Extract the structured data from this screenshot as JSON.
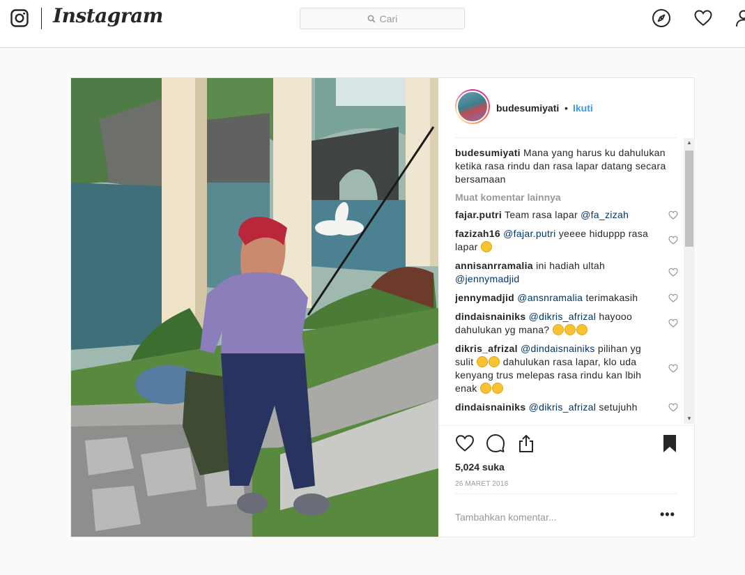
{
  "app": {
    "wordmark": "Instagram",
    "search": {
      "placeholder": "Cari"
    }
  },
  "nav_icons": [
    "compass-icon",
    "heart-icon",
    "profile-icon"
  ],
  "post": {
    "username": "budesumiyati",
    "header_separator": "•",
    "follow_label": "Ikuti",
    "caption": {
      "username": "budesumiyati",
      "text": "Mana yang harus ku dahulukan ketika rasa rindu dan rasa lapar datang secara bersamaan"
    },
    "load_more_label": "Muat komentar lainnya",
    "comments": [
      {
        "username": "fajar.putri",
        "parts": [
          {
            "t": "Team rasa lapar "
          },
          {
            "m": "@fa_zizah"
          }
        ]
      },
      {
        "username": "fazizah16",
        "parts": [
          {
            "m": "@fajar.putri"
          },
          {
            "t": " yeeee hiduppp rasa lapar "
          },
          {
            "e": "grin-sweat"
          }
        ]
      },
      {
        "username": "annisanrramalia",
        "parts": [
          {
            "t": "ini hadiah ultah "
          },
          {
            "m": "@jennymadjid"
          }
        ]
      },
      {
        "username": "jennymadjid",
        "parts": [
          {
            "m": "@ansnramalia"
          },
          {
            "t": " terimakasih"
          }
        ]
      },
      {
        "username": "dindaisnainiks",
        "parts": [
          {
            "m": "@dikris_afrizal"
          },
          {
            "t": " hayooo dahulukan yg mana? "
          },
          {
            "e": "rofl"
          },
          {
            "e": "rofl"
          },
          {
            "e": "rofl"
          }
        ]
      },
      {
        "username": "dikris_afrizal",
        "parts": [
          {
            "m": "@dindaisnainiks"
          },
          {
            "t": " pilihan yg sulit "
          },
          {
            "e": "rofl"
          },
          {
            "e": "rofl"
          },
          {
            "t": " dahulukan rasa lapar, klo uda kenyang trus melepas rasa rindu kan lbih enak "
          },
          {
            "e": "grin-sweat"
          },
          {
            "e": "grin-sweat"
          }
        ]
      },
      {
        "username": "dindaisnainiks",
        "parts": [
          {
            "m": "@dikris_afrizal"
          },
          {
            "t": " setujuhh"
          }
        ]
      }
    ],
    "likes": "5,024 suka",
    "date": "26 MARET 2018",
    "add_comment_placeholder": "Tambahkan komentar...",
    "more_options": "•••"
  },
  "colors": {
    "link_blue": "#3897f0",
    "mention_blue": "#003569",
    "border": "#dbdbdb",
    "muted": "#999999"
  }
}
